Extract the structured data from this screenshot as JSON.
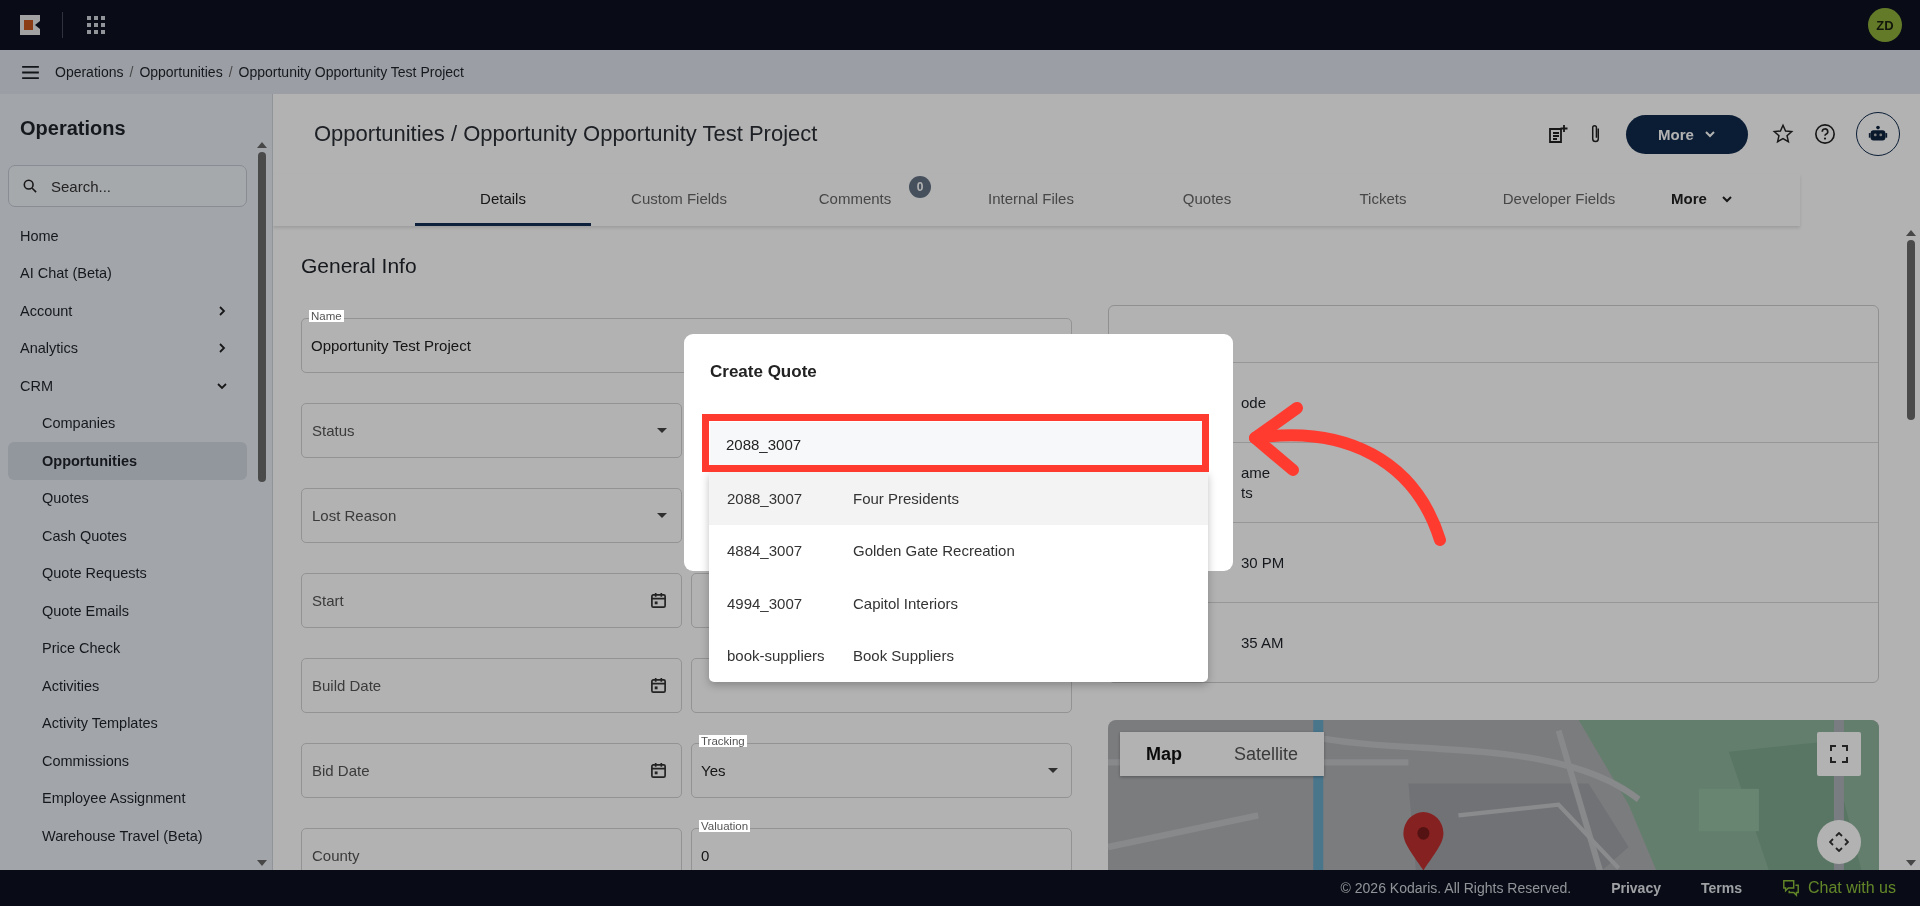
{
  "topbar": {
    "avatar": "ZD"
  },
  "breadcrumb": [
    "Operations",
    "Opportunities",
    "Opportunity Opportunity Test Project"
  ],
  "breadcrumb_separator": "/",
  "sidebar": {
    "title": "Operations",
    "search": {
      "placeholder": "Search..."
    },
    "items": [
      {
        "label": "Home",
        "selected": false
      },
      {
        "label": "AI Chat (Beta)",
        "selected": false
      },
      {
        "label": "Account",
        "selected": false,
        "expanded": false
      },
      {
        "label": "Analytics",
        "selected": false,
        "expanded": false
      },
      {
        "label": "CRM",
        "selected": false,
        "expanded": true,
        "children": [
          {
            "label": "Companies",
            "selected": false
          },
          {
            "label": "Opportunities",
            "selected": true
          },
          {
            "label": "Quotes",
            "selected": false
          },
          {
            "label": "Cash Quotes",
            "selected": false
          },
          {
            "label": "Quote Requests",
            "selected": false
          },
          {
            "label": "Quote Emails",
            "selected": false
          },
          {
            "label": "Price Check",
            "selected": false
          },
          {
            "label": "Activities",
            "selected": false
          },
          {
            "label": "Activity Templates",
            "selected": false
          },
          {
            "label": "Commissions",
            "selected": false
          },
          {
            "label": "Employee Assignment",
            "selected": false
          },
          {
            "label": "Warehouse Travel (Beta)",
            "selected": false
          }
        ]
      }
    ]
  },
  "page": {
    "title": "Opportunities / Opportunity Opportunity Test Project",
    "more_button": "More"
  },
  "tabs": [
    {
      "label": "Details",
      "selected": true
    },
    {
      "label": "Custom Fields",
      "selected": false
    },
    {
      "label": "Comments",
      "selected": false,
      "badge": "0"
    },
    {
      "label": "Internal Files",
      "selected": false
    },
    {
      "label": "Quotes",
      "selected": false
    },
    {
      "label": "Tickets",
      "selected": false
    },
    {
      "label": "Developer Fields",
      "selected": false
    },
    {
      "label": "More",
      "selected": false,
      "kind": "menu"
    }
  ],
  "general_info": {
    "heading": "General Info",
    "name": {
      "label": "Name",
      "value": "Opportunity Test Project"
    },
    "left_fields": [
      {
        "placeholder": "Status",
        "kind": "select"
      },
      {
        "placeholder": "Lost Reason",
        "kind": "select"
      },
      {
        "placeholder": "Start",
        "kind": "date"
      },
      {
        "placeholder": "Build Date",
        "kind": "date"
      },
      {
        "placeholder": "Bid Date",
        "kind": "date"
      },
      {
        "placeholder": "County",
        "kind": "text"
      }
    ],
    "right_fields": [
      {
        "kind": "covered"
      },
      {
        "kind": "covered"
      },
      {
        "kind": "empty"
      },
      {
        "kind": "empty"
      },
      {
        "label": "Tracking",
        "value": "Yes",
        "kind": "select"
      },
      {
        "label": "Valuation",
        "value": "0",
        "kind": "text"
      }
    ]
  },
  "details_card": {
    "rows": [
      {
        "lines": [
          "ode"
        ]
      },
      {
        "lines": [
          "ame",
          "ts"
        ]
      },
      {
        "lines": [
          "30 PM"
        ]
      },
      {
        "lines": [
          "35 AM"
        ]
      }
    ]
  },
  "map": {
    "kind": "picture",
    "map_type": [
      {
        "label": "Map",
        "selected": true
      },
      {
        "label": "Satellite",
        "selected": false
      }
    ]
  },
  "footer": {
    "copyright": "© 2026 Kodaris. All Rights Reserved.",
    "links": [
      "Privacy",
      "Terms"
    ],
    "chat": "Chat with us"
  },
  "dialog": {
    "title": "Create Quote",
    "input": {
      "value": "2088_3007"
    },
    "options": [
      {
        "code": "2088_3007",
        "name": "Four Presidents",
        "selected": true
      },
      {
        "code": "4884_3007",
        "name": "Golden Gate Recreation",
        "selected": false
      },
      {
        "code": "4994_3007",
        "name": "Capitol Interiors",
        "selected": false
      },
      {
        "code": "book-suppliers",
        "name": "Book Suppliers",
        "selected": false
      }
    ]
  }
}
